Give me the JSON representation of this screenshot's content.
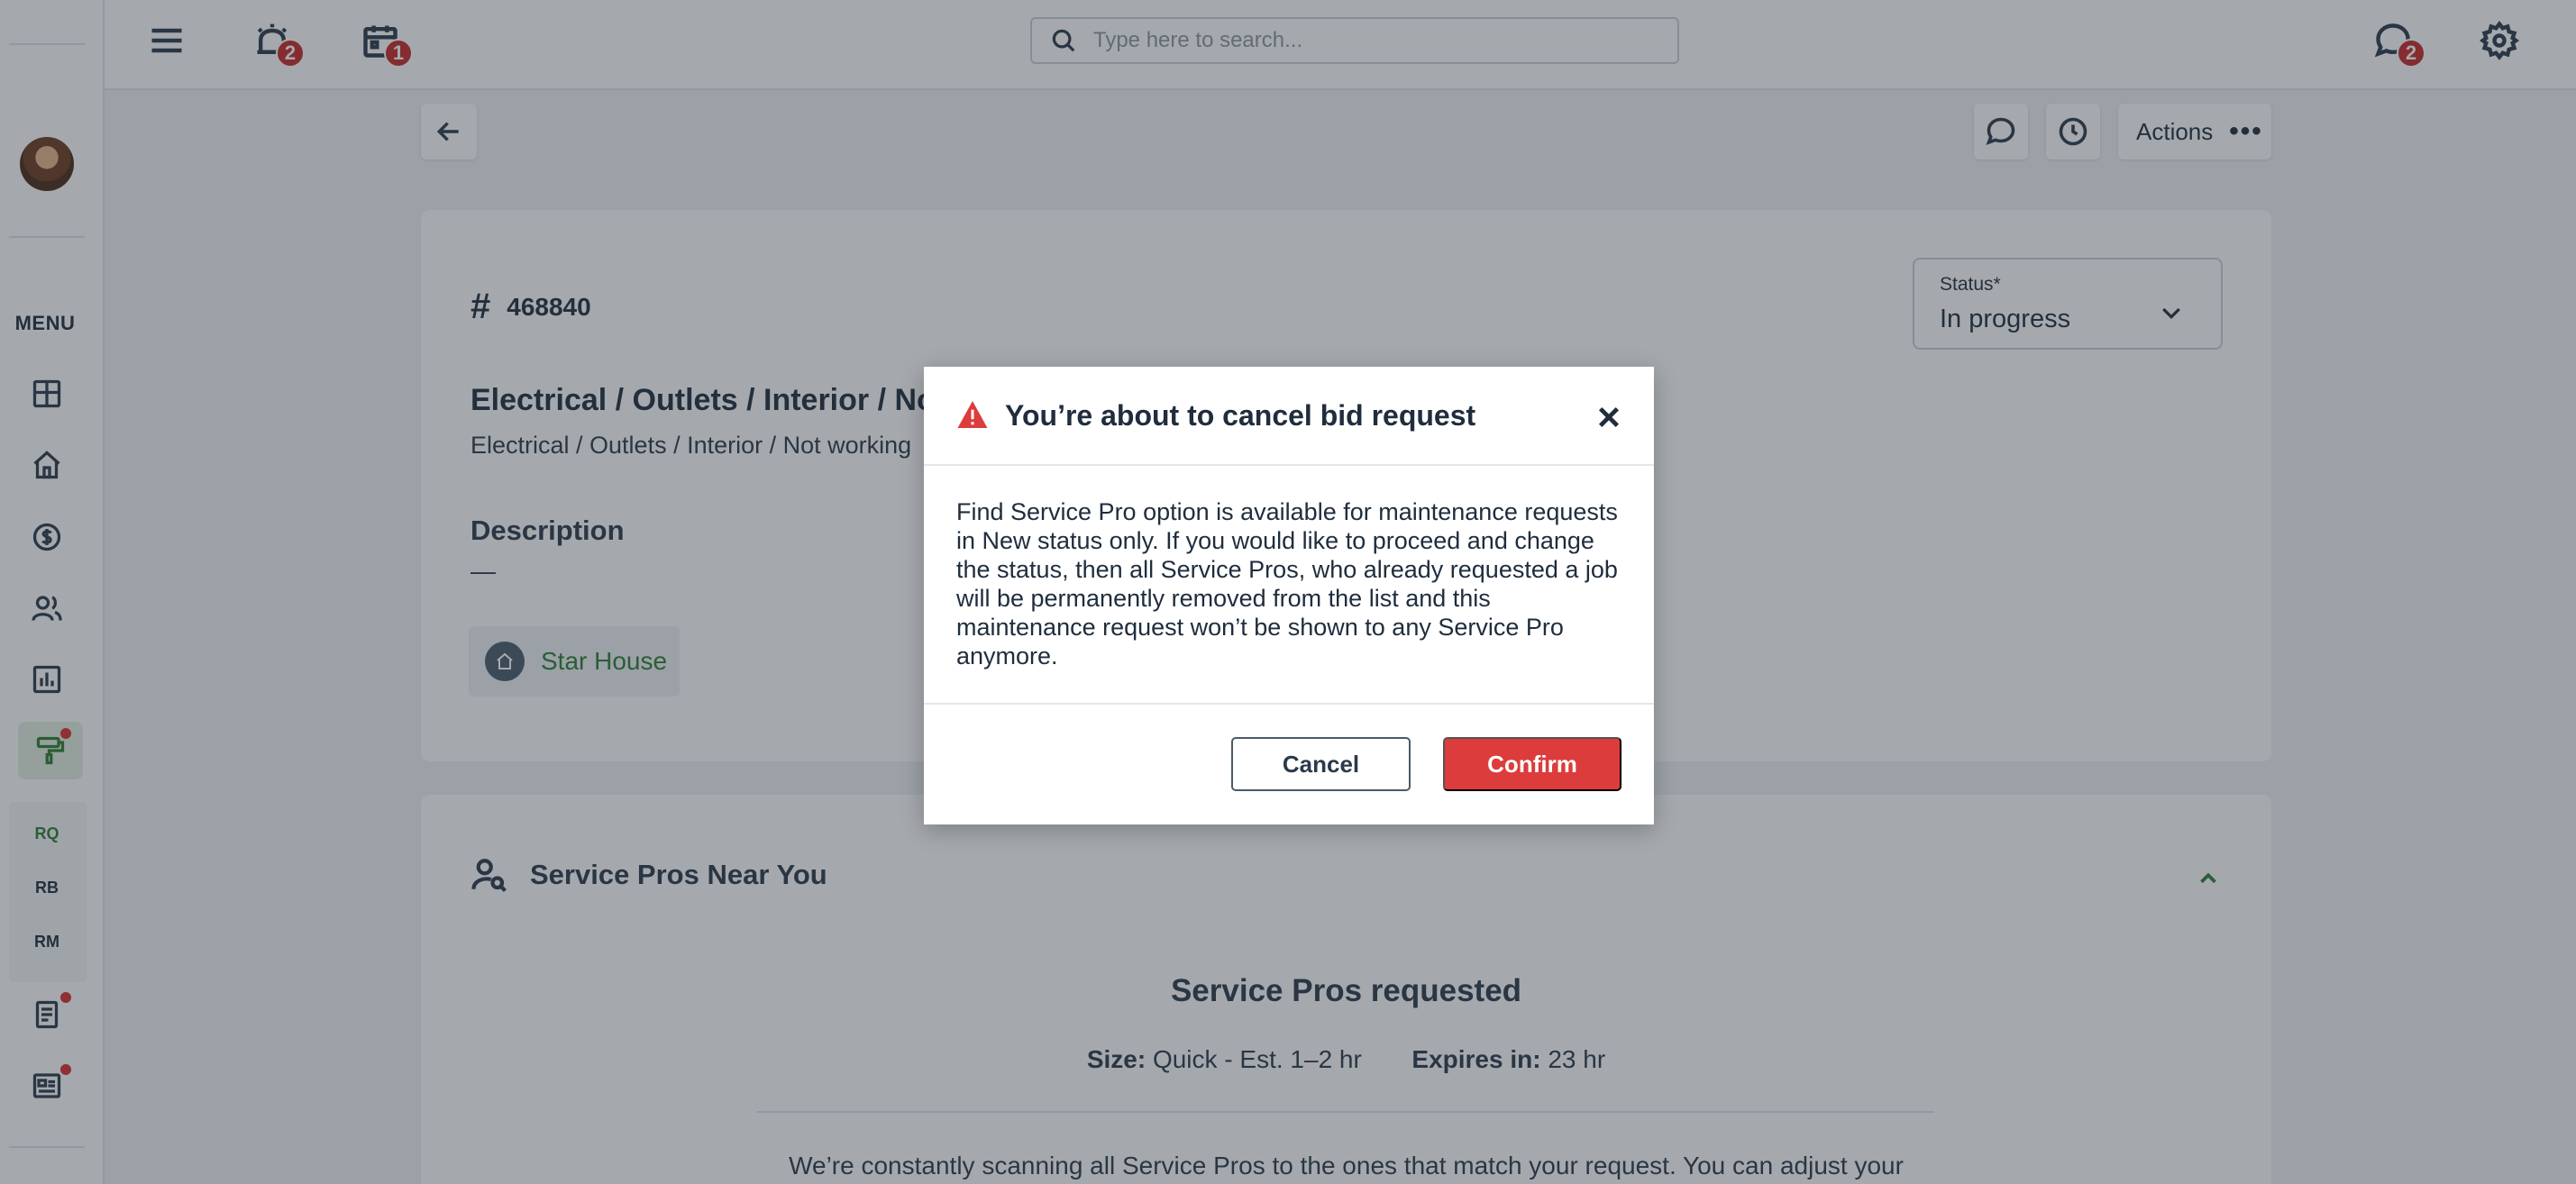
{
  "topbar": {
    "search_placeholder": "Type here to search...",
    "alerts_badge": "2",
    "calendar_badge": "1",
    "messages_badge": "2"
  },
  "sidebar": {
    "menu_label": "MENU",
    "sub_items": [
      "RQ",
      "RB",
      "RM"
    ]
  },
  "toolbar": {
    "actions_label": "Actions",
    "actions_dots": "•••"
  },
  "request": {
    "hash": "#",
    "id": "468840",
    "title": "Electrical / Outlets / Interior / No",
    "subtitle": "Electrical / Outlets / Interior / Not working",
    "description_heading": "Description",
    "description_value": "—",
    "property": "Star House",
    "status_label": "Status*",
    "status_value": "In progress"
  },
  "pros": {
    "heading": "Service Pros Near You",
    "title": "Service Pros requested",
    "size_label": "Size:",
    "size_value": "Quick - Est. 1–2 hr",
    "expires_label": "Expires in:",
    "expires_value": "23 hr",
    "body_text": "We’re constantly scanning all Service Pros to the ones that match your request. You can adjust your"
  },
  "modal": {
    "title": "You’re about to cancel bid request",
    "body": "Find Service Pro option is available for maintenance requests in New status only. If you would like to proceed and change the status, then all Service Pros, who already requested a job will be permanently removed from the list and this maintenance request won’t be shown to any Service Pro anymore.",
    "cancel_label": "Cancel",
    "confirm_label": "Confirm"
  },
  "colors": {
    "accent_green": "#2e7d32",
    "danger_red": "#dc3c3c",
    "badge_red": "#c62828"
  },
  "icons": [
    "hamburger-icon",
    "alarm-icon",
    "calendar-icon",
    "search-icon",
    "chat-icon",
    "gear-icon",
    "back-arrow-icon",
    "comment-icon",
    "history-icon",
    "warning-icon",
    "close-icon",
    "chevron-down-icon",
    "chevron-up-icon",
    "home-icon",
    "dashboard-icon",
    "dollar-icon",
    "users-icon",
    "chart-icon",
    "paint-roller-icon",
    "document-icon",
    "newspaper-icon",
    "user-search-icon"
  ]
}
